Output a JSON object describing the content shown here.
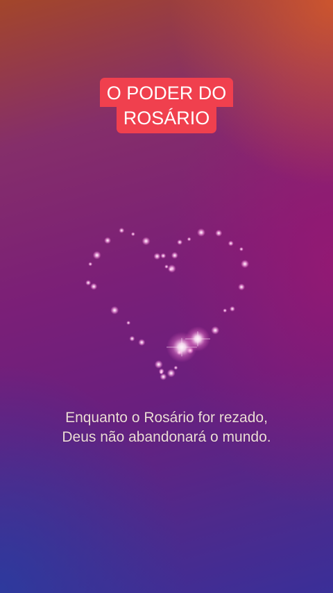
{
  "title": {
    "line1": "O PODER DO",
    "line2": "ROSÁRIO"
  },
  "caption": {
    "line1": "Enquanto o Rosário for rezado,",
    "line2": "Deus não abandonará o mundo."
  },
  "colors": {
    "title_bg": "#f0404e",
    "title_text": "#ffffff",
    "caption_text": "#ecdbd6",
    "sparkle": "#ffd6f4"
  },
  "decoration": {
    "icon": "heart-sparkles-icon"
  }
}
